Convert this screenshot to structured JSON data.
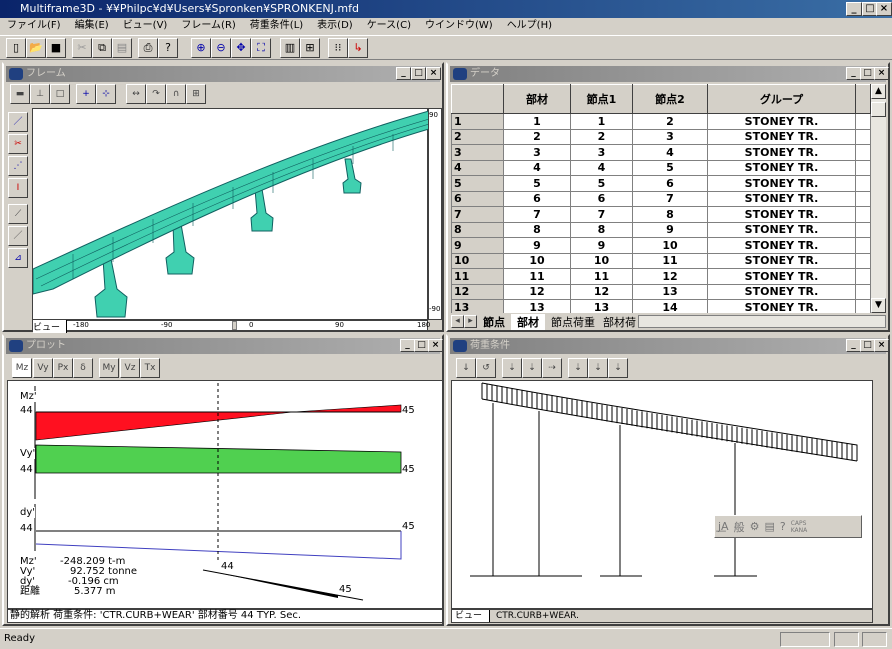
{
  "app": {
    "title": "Multiframe3D - ¥¥Philpc¥d¥Users¥Spronken¥SPRONKENJ.mfd"
  },
  "menu": [
    "ファイル(F)",
    "編集(E)",
    "ビュー(V)",
    "フレーム(R)",
    "荷重条件(L)",
    "表示(D)",
    "ケース(C)",
    "ウインドウ(W)",
    "ヘルプ(H)"
  ],
  "frame_window": {
    "title": "フレーム",
    "view_tab": "ビュー",
    "ruler_labels": [
      "-180",
      "-90",
      "0",
      "90",
      "180"
    ],
    "side_labels": [
      "90",
      "-90"
    ]
  },
  "data_window": {
    "title": "データ",
    "columns": [
      "",
      "部材",
      "節点1",
      "節点2",
      "グループ"
    ],
    "rows": [
      [
        "1",
        "1",
        "1",
        "2",
        "STONEY TR."
      ],
      [
        "2",
        "2",
        "2",
        "3",
        "STONEY TR."
      ],
      [
        "3",
        "3",
        "3",
        "4",
        "STONEY TR."
      ],
      [
        "4",
        "4",
        "4",
        "5",
        "STONEY TR."
      ],
      [
        "5",
        "5",
        "5",
        "6",
        "STONEY TR."
      ],
      [
        "6",
        "6",
        "6",
        "7",
        "STONEY TR."
      ],
      [
        "7",
        "7",
        "7",
        "8",
        "STONEY TR."
      ],
      [
        "8",
        "8",
        "8",
        "9",
        "STONEY TR."
      ],
      [
        "9",
        "9",
        "9",
        "10",
        "STONEY TR."
      ],
      [
        "10",
        "10",
        "10",
        "11",
        "STONEY TR."
      ],
      [
        "11",
        "11",
        "11",
        "12",
        "STONEY TR."
      ],
      [
        "12",
        "12",
        "12",
        "13",
        "STONEY TR."
      ],
      [
        "13",
        "13",
        "13",
        "14",
        "STONEY TR."
      ]
    ],
    "tabs": [
      "節点",
      "部材",
      "節点荷重",
      "部材荷"
    ],
    "active_tab": "部材"
  },
  "plot_window": {
    "title": "プロット",
    "tool_labels": [
      "Mz",
      "Vy",
      "Px",
      "δ",
      "My",
      "Vz",
      "Tx"
    ],
    "diagrams": [
      {
        "label": "Mz'",
        "start": "44",
        "end": "45",
        "color": "#ff0000"
      },
      {
        "label": "Vy'",
        "start": "44",
        "end": "45",
        "color": "#50d050"
      },
      {
        "label": "dy'",
        "start": "44",
        "end": "45",
        "color": "#4040c0"
      }
    ],
    "readout": [
      {
        "label": "Mz'",
        "value": "-248.209 t-m"
      },
      {
        "label": "Vy'",
        "value": "92.752 tonne"
      },
      {
        "label": "dy'",
        "value": "-0.196 cm"
      },
      {
        "label": "距離",
        "value": "5.377 m"
      }
    ],
    "member_start": "44",
    "member_end": "45",
    "status": "静的解析 荷重条件: 'CTR.CURB+WEAR'  部材番号 44  TYP. Sec."
  },
  "load_window": {
    "title": "荷重条件",
    "view_tab": "ビュー",
    "case": "CTR.CURB+WEAR."
  },
  "ime": {
    "caps": "CAPS",
    "kana": "KANA",
    "mode": "般"
  },
  "status_bar": {
    "text": "Ready"
  }
}
